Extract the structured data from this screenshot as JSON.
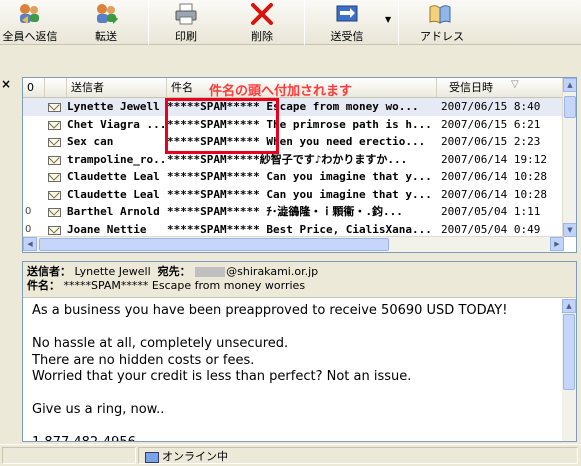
{
  "toolbar": {
    "reply_all": "全員へ返信",
    "forward": "転送",
    "print": "印刷",
    "delete": "削除",
    "send_receive": "送受信",
    "address": "アドレス"
  },
  "list": {
    "headers": {
      "attachment": "0",
      "from": "送信者",
      "subject": "件名",
      "date": "受信日時"
    },
    "annotation": "件名の頭へ付加されます",
    "rows": [
      {
        "attach": "",
        "from": "Lynette Jewell",
        "subject": "*****SPAM***** Escape from money wo...",
        "date": "2007/06/15 8:40",
        "selected": true
      },
      {
        "attach": "",
        "from": "Chet Viagra ...",
        "subject": "*****SPAM***** The primrose path is h...",
        "date": "2007/06/15 6:21"
      },
      {
        "attach": "",
        "from": "Sex can",
        "subject": "*****SPAM***** When you need erectio...",
        "date": "2007/06/15 2:23"
      },
      {
        "attach": "",
        "from": "trampoline_ro...",
        "subject": "*****SPAM*****紗智子です♪わかりますか...",
        "date": "2007/06/14 19:12"
      },
      {
        "attach": "",
        "from": "Claudette Leal",
        "subject": "*****SPAM***** Can you imagine that y...",
        "date": "2007/06/14 10:28"
      },
      {
        "attach": "",
        "from": "Claudette Leal",
        "subject": "*****SPAM***** Can you imagine that y...",
        "date": "2007/06/14 10:28"
      },
      {
        "attach": "0",
        "from": "Barthel Arnold",
        "subject": "*****SPAM***** ﾁ･澁鵒隆・ｉ顆衞・.鈞...",
        "date": "2007/05/04 1:11"
      },
      {
        "attach": "0",
        "from": "Joane Nettie",
        "subject": "*****SPAM***** Best Price, CialisXana...",
        "date": "2007/05/04 0:49"
      }
    ]
  },
  "preview": {
    "from_label": "送信者：",
    "from_value": "Lynette Jewell",
    "to_label": "宛先：",
    "to_value": "@shirakami.or.jp",
    "subject_label": "件名：",
    "subject_value": "*****SPAM***** Escape from money worries",
    "body": [
      "As a business you have been preapproved to receive 50690 USD TODAY!",
      "",
      "No hassle at all, completely unsecured.",
      "There are no hidden costs or fees.",
      "Worried that your credit is less than perfect? Not an issue.",
      "",
      "Give us a ring, now..",
      "",
      "1 877 482-4956"
    ]
  },
  "status": {
    "online": "オンライン中"
  },
  "colors": {
    "annotation": "#ff3a3a",
    "highlight_box": "#e8001c"
  }
}
